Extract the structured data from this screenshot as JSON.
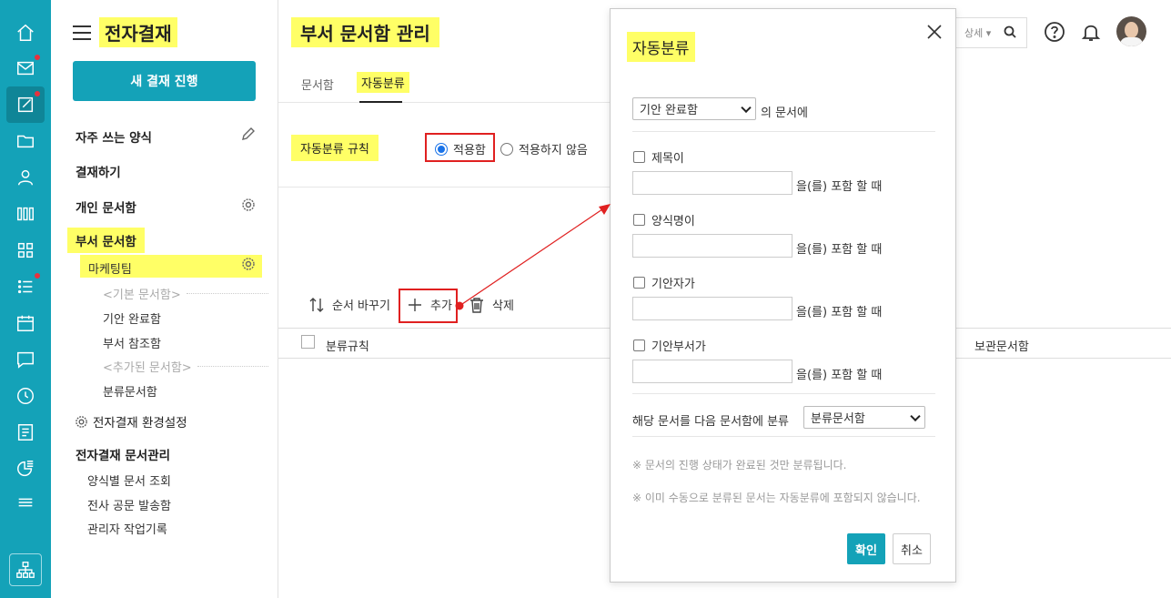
{
  "sidebar": {
    "title": "전자결재",
    "new_button": "새 결재 진행",
    "favorites": "자주 쓰는 양식",
    "approve": "결재하기",
    "personal_box": "개인 문서함",
    "dept_box": "부서 문서함",
    "dept_name": "마케팅팀",
    "group_basic": "<기본 문서함>",
    "done_box": "기안 완료함",
    "ref_box": "부서 참조함",
    "group_added": "<추가된 문서함>",
    "classify_box": "분류문서함",
    "env_settings": "전자결재 환경설정",
    "admin_title": "전자결재 문서관리",
    "admin_items": [
      "양식별 문서 조회",
      "전사 공문 발송함",
      "관리자 작업기록"
    ]
  },
  "main": {
    "title": "부서 문서함 관리",
    "tabs": [
      "문서함",
      "자동분류"
    ],
    "rule_label": "자동분류 규칙",
    "radio_apply": "적용함",
    "radio_not_apply": "적용하지 않음",
    "tool_reorder": "순서 바꾸기",
    "tool_add": "추가",
    "tool_delete": "삭제",
    "col_rule": "분류규칙",
    "col_box": "보관문서함"
  },
  "header": {
    "search_detail": "상세"
  },
  "modal": {
    "title": "자동분류",
    "source_select": "기안 완료함",
    "source_suffix": "의 문서에",
    "conditions": [
      {
        "label": "제목이",
        "suffix": "을(를) 포함 할 때"
      },
      {
        "label": "양식명이",
        "suffix": "을(를) 포함 할 때"
      },
      {
        "label": "기안자가",
        "suffix": "을(를) 포함 할 때"
      },
      {
        "label": "기안부서가",
        "suffix": "을(를) 포함 할 때"
      }
    ],
    "target_label": "해당 문서를 다음 문서함에 분류",
    "target_select": "분류문서함",
    "note1": "※ 문서의 진행 상태가 완료된 것만 분류됩니다.",
    "note2": "※ 이미 수동으로 분류된 문서는 자동분류에 포함되지 않습니다.",
    "ok": "확인",
    "cancel": "취소"
  },
  "colors": {
    "accent": "#14a2b8",
    "highlight": "#ffff66",
    "annotation": "#e02020"
  }
}
